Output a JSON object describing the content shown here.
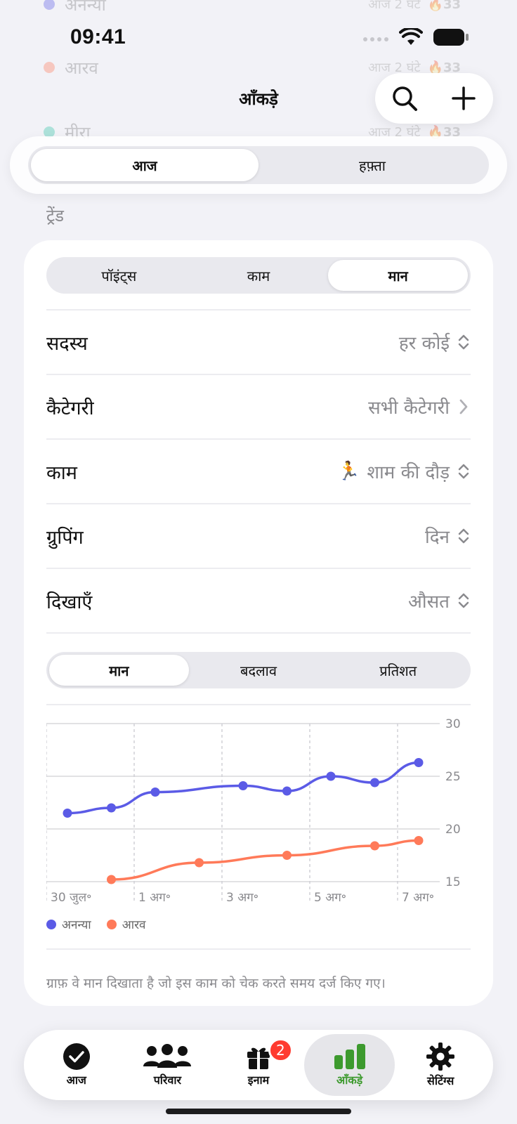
{
  "status_bar": {
    "time": "09:41"
  },
  "background_list": [
    {
      "name": "अनन्या",
      "meta": "आज 2 घंटे",
      "streak": "33",
      "color": "#5b5be6"
    },
    {
      "name": "आरव",
      "meta": "आज 2 घंटे",
      "streak": "33",
      "color": "#ff7a59"
    },
    {
      "name": "मीरा",
      "meta": "आज 2 घंटे",
      "streak": "33",
      "color": "#2ec4a6"
    }
  ],
  "header": {
    "title": "आँकड़े"
  },
  "period_tabs": {
    "today": "आज",
    "week": "हफ़्ता",
    "selected": "today"
  },
  "section_label": "ट्रेंड",
  "metric_tabs": {
    "points": "पॉइंट्स",
    "tasks": "काम",
    "value": "मान",
    "selected": "value"
  },
  "filters": {
    "member": {
      "label": "सदस्य",
      "value": "हर कोई"
    },
    "category": {
      "label": "कैटेगरी",
      "value": "सभी कैटेगरी"
    },
    "task": {
      "label": "काम",
      "emoji": "🏃",
      "value": "शाम की दौड़"
    },
    "grouping": {
      "label": "ग्रुपिंग",
      "value": "दिन"
    },
    "show": {
      "label": "दिखाएँ",
      "value": "औसत"
    }
  },
  "chart_mode_tabs": {
    "value": "मान",
    "change": "बदलाव",
    "percent": "प्रतिशत",
    "selected": "value"
  },
  "chart_data": {
    "type": "line",
    "x": [
      "30 जुल॰",
      "31 जुल॰",
      "1 अग॰",
      "2 अग॰",
      "3 अग॰",
      "4 अग॰",
      "5 अग॰",
      "6 अग॰",
      "7 अग॰"
    ],
    "x_tick_labels": [
      "30 जुल॰",
      "1 अग॰",
      "3 अग॰",
      "5 अग॰",
      "7 अग॰"
    ],
    "ylim": [
      15,
      30
    ],
    "y_ticks": [
      "30",
      "25",
      "20",
      "15"
    ],
    "grid": true,
    "series": [
      {
        "name": "अनन्या",
        "color": "#5b5be6",
        "values": [
          21.5,
          22.0,
          23.5,
          null,
          24.1,
          23.6,
          25.0,
          24.4,
          26.3
        ]
      },
      {
        "name": "आरव",
        "color": "#ff7a59",
        "values": [
          null,
          15.2,
          null,
          16.8,
          null,
          17.5,
          null,
          18.4,
          18.9
        ]
      }
    ],
    "legend": "bottom-left"
  },
  "footnote": "ग्राफ़ वे मान दिखाता है जो इस काम को चेक करते समय दर्ज किए गए।",
  "tabbar": {
    "today": "आज",
    "family": "परिवार",
    "rewards": "इनाम",
    "rewards_badge": "2",
    "stats": "आँकड़े",
    "settings": "सेटिंग्स",
    "active_color": "#3d9a2e"
  }
}
